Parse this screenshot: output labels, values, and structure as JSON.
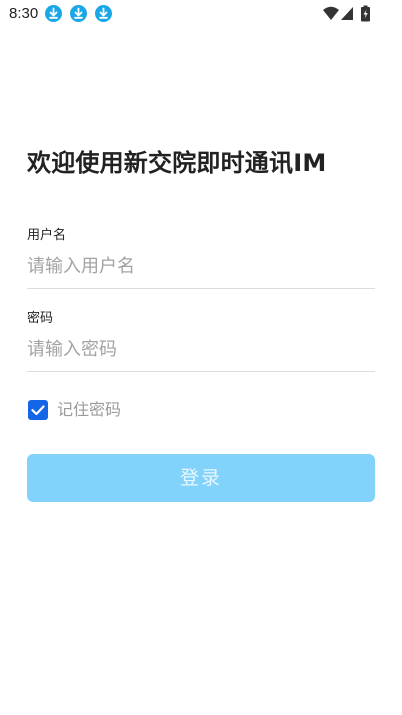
{
  "status_bar": {
    "time": "8:30",
    "download_icons": [
      "download-icon",
      "download-icon",
      "download-icon"
    ],
    "system_icons": [
      "wifi-icon",
      "cell-signal-icon",
      "battery-charging-icon"
    ],
    "accent": "#1aa7e8"
  },
  "login": {
    "title": "欢迎使用新交院即时通讯IM",
    "username": {
      "label": "用户名",
      "placeholder": "请输入用户名",
      "value": ""
    },
    "password": {
      "label": "密码",
      "placeholder": "请输入密码",
      "value": ""
    },
    "remember": {
      "label": "记住密码",
      "checked": true,
      "color": "#1565e8"
    },
    "submit": {
      "label": "登录",
      "color": "#82d3fc",
      "enabled": false
    }
  }
}
